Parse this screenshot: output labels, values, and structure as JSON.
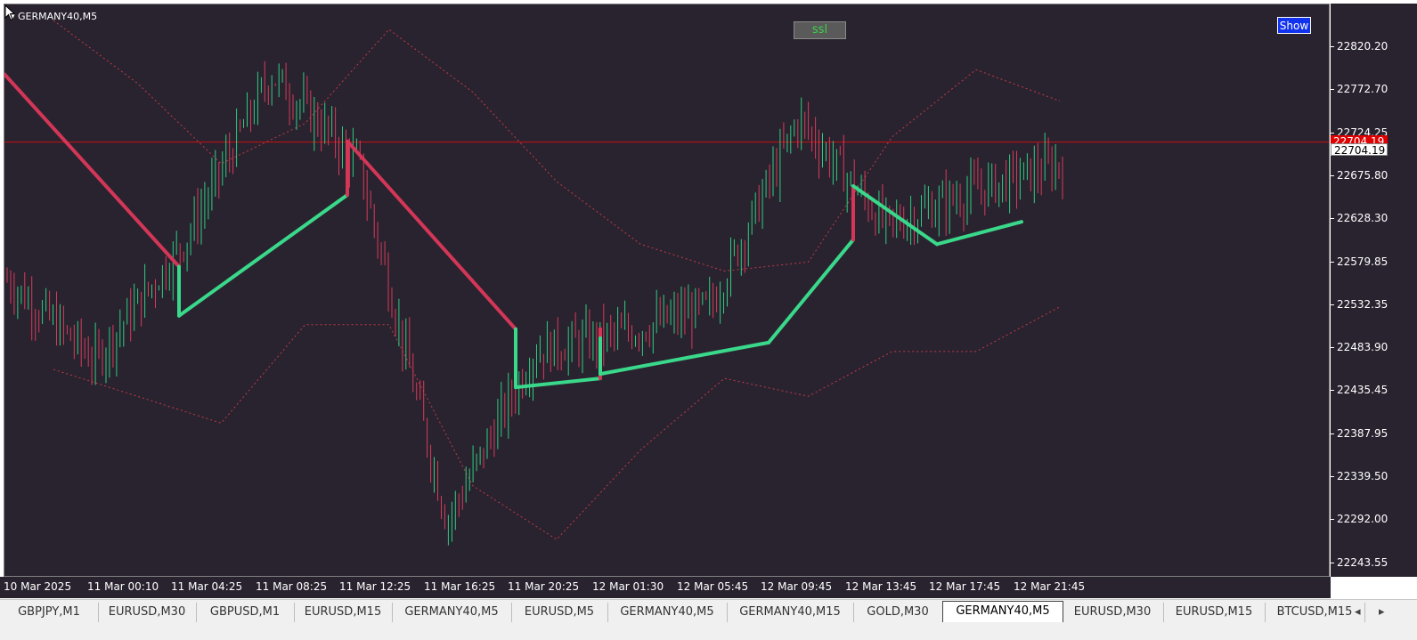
{
  "chart": {
    "symbol_label": "GERMANY40,M5",
    "ssl_label": "ssl",
    "show_button": "Show",
    "current_price_red": "22704.19",
    "current_price_white": "22704.19",
    "colors": {
      "background": "#29232f",
      "bull_candle": "#2ecc80",
      "bear_candle": "#d63a5a",
      "ssl_up": "#3ad88a",
      "ssl_down": "#d33657",
      "band": "#c03a4a",
      "price_line": "#cc1111"
    }
  },
  "price_axis": {
    "labels": [
      "22820.20",
      "22772.70",
      "22724.25",
      "22675.80",
      "22628.30",
      "22579.85",
      "22532.35",
      "22483.90",
      "22435.45",
      "22387.95",
      "22339.50",
      "22292.00",
      "22243.55"
    ]
  },
  "time_axis": {
    "labels": [
      "10 Mar 2025",
      "11 Mar 00:10",
      "11 Mar 04:25",
      "11 Mar 08:25",
      "11 Mar 12:25",
      "11 Mar 16:25",
      "11 Mar 20:25",
      "12 Mar 01:30",
      "12 Mar 05:45",
      "12 Mar 09:45",
      "12 Mar 13:45",
      "12 Mar 17:45",
      "12 Mar 21:45"
    ]
  },
  "tabs": {
    "items": [
      "GBPJPY,M1",
      "EURUSD,M30",
      "GBPUSD,M1",
      "EURUSD,M15",
      "GERMANY40,M5",
      "EURUSD,M5",
      "GERMANY40,M5",
      "GERMANY40,M15",
      "GOLD,M30",
      "GERMANY40,M5",
      "EURUSD,M30",
      "EURUSD,M15",
      "BTCUSD,M15"
    ],
    "active_index": 9,
    "prev_arrow": "◂",
    "next_arrow": "▸"
  },
  "chart_data": {
    "type": "candlestick",
    "symbol": "GERMANY40",
    "timeframe": "M5",
    "ylim": [
      22220,
      22850
    ],
    "current_price": 22704.19,
    "x": [
      "10 Mar 2025",
      "11 Mar 00:10",
      "11 Mar 04:25",
      "11 Mar 08:25",
      "11 Mar 12:25",
      "11 Mar 16:25",
      "11 Mar 20:25",
      "12 Mar 01:30",
      "12 Mar 05:45",
      "12 Mar 09:45",
      "12 Mar 13:45",
      "12 Mar 17:45",
      "12 Mar 21:45"
    ],
    "close_approx": [
      22560,
      22470,
      22600,
      22790,
      22690,
      22290,
      22480,
      22500,
      22530,
      22740,
      22620,
      22660,
      22690
    ],
    "ssl_line": [
      {
        "x": "10 Mar 2025",
        "y": 22790,
        "trend": "down"
      },
      {
        "x": "11 Mar 04:25",
        "y": 22575,
        "trend": "down"
      },
      {
        "x": "11 Mar 04:25",
        "y": 22520,
        "trend": "up"
      },
      {
        "x": "11 Mar 12:25",
        "y": 22655,
        "trend": "up"
      },
      {
        "x": "11 Mar 12:25",
        "y": 22715,
        "trend": "down"
      },
      {
        "x": "11 Mar 20:25",
        "y": 22505,
        "trend": "down"
      },
      {
        "x": "11 Mar 20:25",
        "y": 22440,
        "trend": "up"
      },
      {
        "x": "12 Mar 01:30",
        "y": 22450,
        "trend": "up"
      },
      {
        "x": "12 Mar 01:30",
        "y": 22505,
        "trend": "down"
      },
      {
        "x": "12 Mar 01:30",
        "y": 22495,
        "trend": "down"
      },
      {
        "x": "12 Mar 01:30",
        "y": 22455,
        "trend": "up"
      },
      {
        "x": "12 Mar 09:45",
        "y": 22490,
        "trend": "up"
      },
      {
        "x": "12 Mar 13:45",
        "y": 22605,
        "trend": "up"
      },
      {
        "x": "12 Mar 13:45",
        "y": 22665,
        "trend": "down"
      },
      {
        "x": "12 Mar 17:45",
        "y": 22600,
        "trend": "up"
      },
      {
        "x": "12 Mar 21:45",
        "y": 22625,
        "trend": "up"
      }
    ],
    "upper_band": [
      22850,
      22780,
      22690,
      22735,
      22840,
      22770,
      22670,
      22600,
      22570,
      22580,
      22720,
      22795,
      22760
    ],
    "lower_band": [
      22460,
      22430,
      22400,
      22510,
      22510,
      22330,
      22270,
      22370,
      22450,
      22430,
      22480,
      22480,
      22530
    ]
  }
}
